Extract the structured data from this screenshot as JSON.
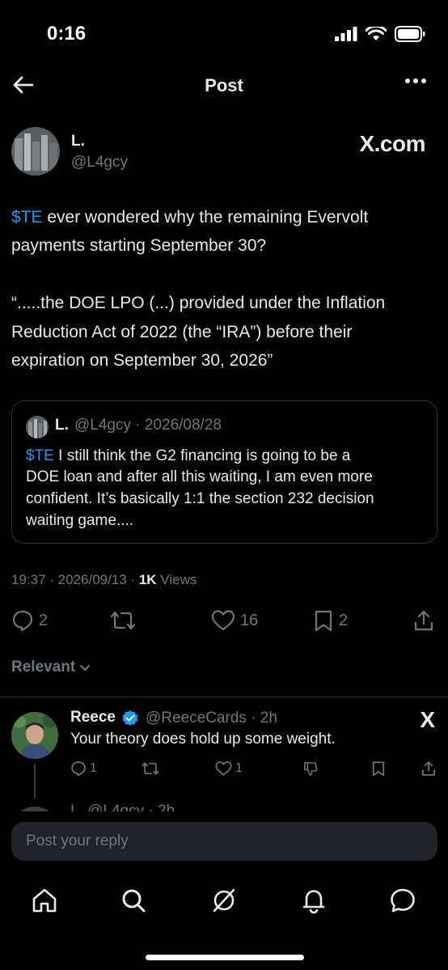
{
  "status_bar": {
    "time": "0:16"
  },
  "header": {
    "title": "Post"
  },
  "post": {
    "author_name": "L.",
    "author_handle": "@L4gcy",
    "source_logo": "X.com",
    "lines": [
      {
        "ticker": "$TE",
        "text": " ever wondered why the remaining Evervolt"
      },
      {
        "text": "payments starting September 30?"
      },
      {
        "text": "“.....the DOE LPO (...) provided under the Inflation"
      },
      {
        "text": "Reduction Act of 2022 (the “IRA”) before their"
      },
      {
        "text": "expiration on September 30, 2026”"
      }
    ],
    "quote": {
      "author_name": "L.",
      "meta": "@L4gcy · 2026/08/28",
      "lines": [
        {
          "ticker": "$TE",
          "text": " I still think the G2 financing is going to be a"
        },
        {
          "text": "DOE loan and after all this waiting, I am even more"
        },
        {
          "text": "confident. It’s basically 1:1 the section 232 decision"
        },
        {
          "text": "waiting game...."
        }
      ]
    },
    "timestamp": "19:37 · 2026/09/13 · ",
    "views_count": "1K",
    "views_label": " Views",
    "actions": {
      "replies": "2",
      "likes": "16",
      "bookmarks": "2"
    }
  },
  "sort": {
    "label": "Relevant"
  },
  "reply": {
    "name": "Reece",
    "meta": "@ReeceCards · 2h",
    "text": "Your theory does hold up some weight.",
    "replies": "1",
    "likes": "1",
    "source_logo": "X"
  },
  "next_reply_peek": "L.  @L4gcy · 2h",
  "composer": {
    "placeholder": "Post your reply"
  },
  "colors": {
    "background": "#000000",
    "accent": "#1d9bf0",
    "muted": "#71767b",
    "text": "#e7e9ea"
  }
}
